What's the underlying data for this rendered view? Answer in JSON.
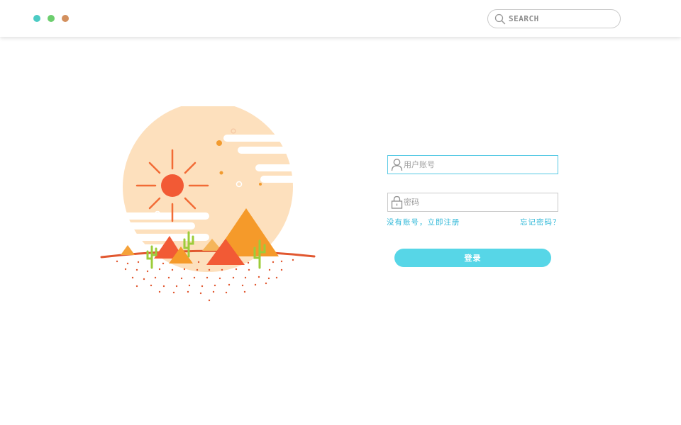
{
  "window_controls": {
    "colors": [
      "#4ccbc4",
      "#6cce6e",
      "#d3905e"
    ]
  },
  "search": {
    "placeholder": "SEARCH",
    "icon": "search-icon"
  },
  "illustration": {
    "subject": "desert-pyramids-sun"
  },
  "login_form": {
    "username_placeholder": "用户账号",
    "username_icon": "user-icon",
    "password_placeholder": "密码",
    "password_icon": "lock-icon",
    "register_link": "没有账号，立即注册",
    "forgot_link": "忘记密码？",
    "login_button": "登录"
  },
  "colors": {
    "accent": "#57d6e7",
    "link": "#2fb8d8",
    "input_focus_border": "#56c9e4"
  }
}
